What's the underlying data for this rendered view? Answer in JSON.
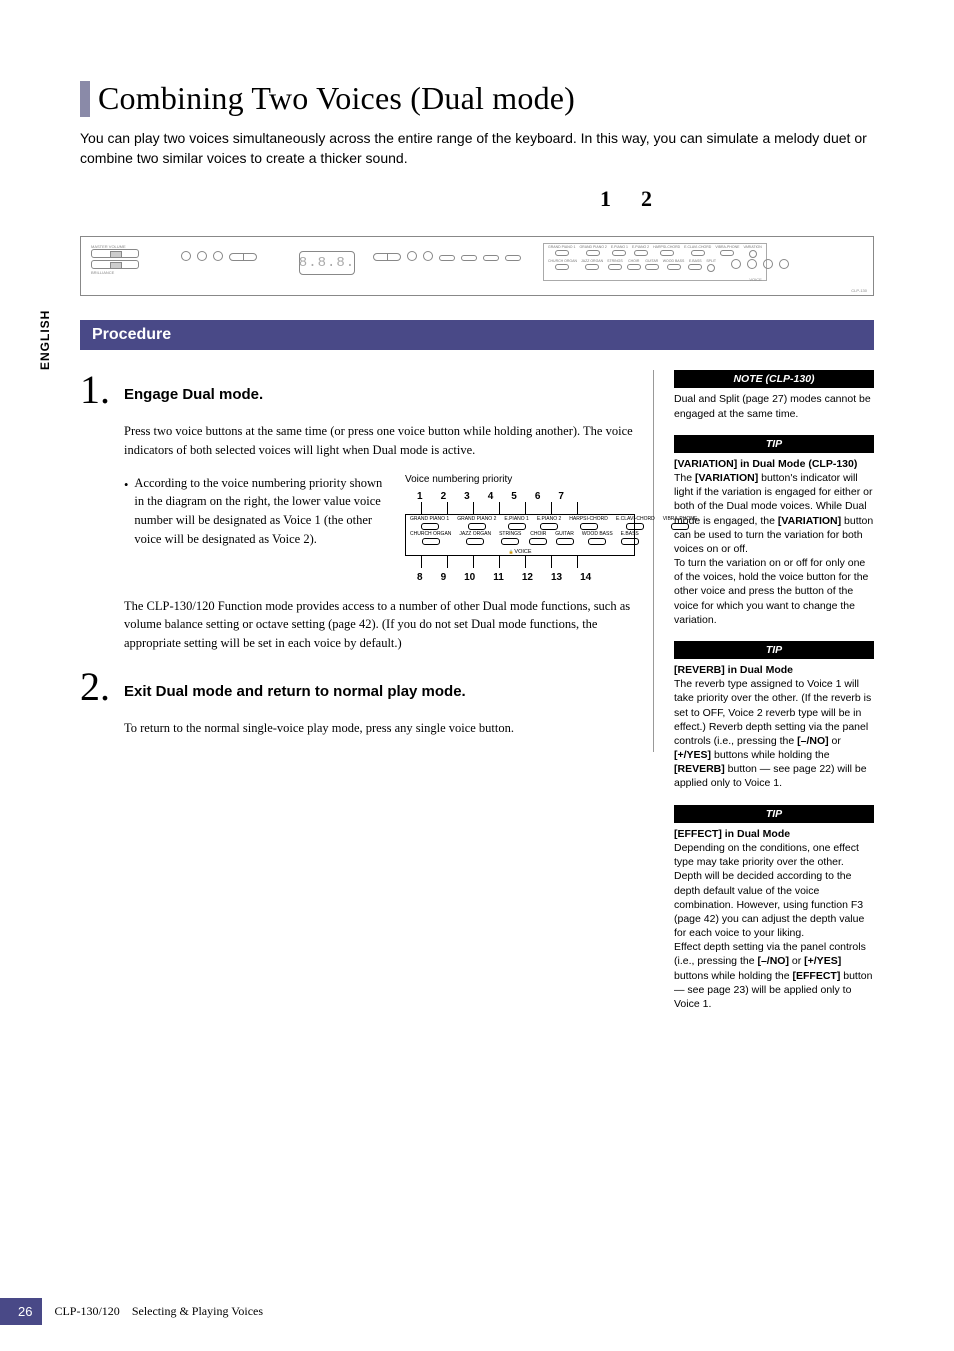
{
  "lang_tab": "ENGLISH",
  "title": "Combining Two Voices (Dual mode)",
  "intro": "You can play two voices simultaneously across the entire range of the keyboard. In this way, you can simulate a melody duet or combine two similar voices to create a thicker sound.",
  "callouts": {
    "n1": "1",
    "n2": "2"
  },
  "panel": {
    "display": "8.8.8.",
    "voice_section_label": "VOICE",
    "model": "CLP-130",
    "voices_top": [
      "GRAND PIANO 1",
      "GRAND PIANO 2",
      "E.PIANO 1",
      "E.PIANO 2",
      "HARPSI-CHORD",
      "E.CLAVI-CHORD",
      "VIBRA-PHONE"
    ],
    "voices_bot": [
      "CHURCH ORGAN",
      "JAZZ ORGAN",
      "STRINGS",
      "CHOIR",
      "GUITAR",
      "WOOD BASS",
      "E.BASS"
    ]
  },
  "procedure_label": "Procedure",
  "steps": {
    "s1": {
      "num": "1.",
      "head": "Engage Dual mode.",
      "p1": "Press two voice buttons at the same time (or press one voice button while holding another). The voice indicators of both selected voices will light when Dual mode is active.",
      "bullet": "According to the voice numbering priority shown in the diagram on the right, the lower value voice number will be designated as Voice 1 (the other voice will be designated as Voice 2).",
      "priority_title": "Voice numbering priority",
      "top_nums": [
        "1",
        "2",
        "3",
        "4",
        "5",
        "6",
        "7"
      ],
      "bot_nums": [
        "8",
        "9",
        "10",
        "11",
        "12",
        "13",
        "14"
      ],
      "grid_top": [
        "GRAND PIANO 1",
        "GRAND PIANO 2",
        "E.PIANO 1",
        "E.PIANO 2",
        "HARPSI-CHORD",
        "E.CLAVI-CHORD",
        "VIBRA-PHONE"
      ],
      "grid_bot": [
        "CHURCH ORGAN",
        "JAZZ ORGAN",
        "STRINGS",
        "CHOIR",
        "GUITAR",
        "WOOD BASS",
        "E.BASS"
      ],
      "grid_label": "VOICE",
      "p2": "The CLP-130/120 Function mode provides access to a number of other Dual mode functions, such as volume balance setting or octave setting (page 42). (If you do not set Dual mode functions, the appropriate setting will be set in each voice by default.)"
    },
    "s2": {
      "num": "2.",
      "head": "Exit Dual mode and return to normal play mode.",
      "p1": "To return to the normal single-voice play mode, press any single voice button."
    }
  },
  "sidebar": {
    "note": {
      "hd": "NOTE (CLP-130)",
      "body": "Dual and Split (page 27) modes cannot be engaged at the same time."
    },
    "tip1": {
      "hd": "TIP",
      "title": "[VARIATION] in Dual Mode (CLP-130)",
      "body1a": "The ",
      "body1_bold1": "[VARIATION]",
      "body1b": " button's indicator will light if the variation is engaged for either or both of the Dual mode voices. While Dual mode is engaged, the ",
      "body1_bold2": "[VARIATION]",
      "body1c": " button can be used to turn the variation for both voices on or off.",
      "body2": "To turn the variation on or off for only one of the voices, hold the voice button for the other voice and press the button of the voice for which you want to change the variation."
    },
    "tip2": {
      "hd": "TIP",
      "title": "[REVERB] in Dual Mode",
      "body_a": "The reverb type assigned to Voice 1 will take priority over the other. (If the reverb is set to OFF, Voice 2 reverb type will be in effect.) Reverb depth setting via the panel controls (i.e., pressing the ",
      "bold1": "[–/NO]",
      "body_b": " or ",
      "bold2": "[+/YES]",
      "body_c": " buttons while holding the ",
      "bold3": "[REVERB]",
      "body_d": " button — see page 22) will be applied only to Voice 1."
    },
    "tip3": {
      "hd": "TIP",
      "title": "[EFFECT] in Dual Mode",
      "body1": "Depending on the conditions, one effect type may take priority over the other. Depth will be decided according to the depth default value of the voice combination. However, using function F3 (page 42) you can adjust the depth value for each voice to your liking.",
      "body2a": "Effect depth setting via the panel controls (i.e., pressing the ",
      "bold1": "[–/NO]",
      "body2b": " or ",
      "bold2": "[+/YES]",
      "body2c": " buttons while holding the ",
      "bold3": "[EFFECT]",
      "body2d": " button — see page 23) will be applied only to Voice 1."
    }
  },
  "footer": {
    "page": "26",
    "model": "CLP-130/120",
    "section": "Selecting & Playing Voices"
  }
}
